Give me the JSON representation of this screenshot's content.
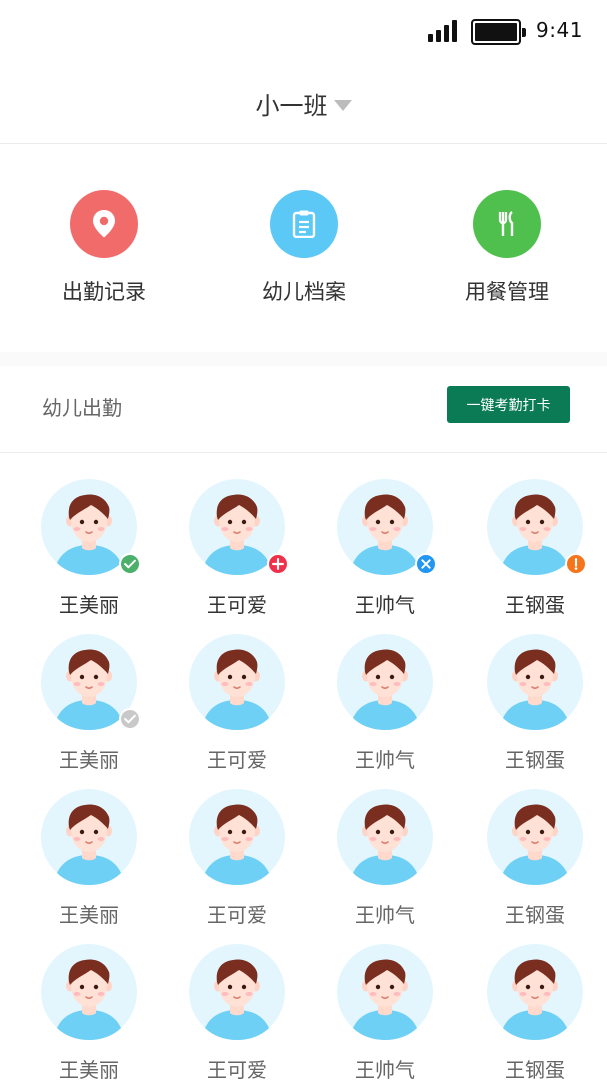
{
  "status_bar": {
    "time": "9:41",
    "signal_bars": 4,
    "battery_level": 1.0
  },
  "header": {
    "class_name": "小一班"
  },
  "quick_menu": [
    {
      "label": "出勤记录",
      "icon": "location-pin-icon",
      "color": "#f26b6b"
    },
    {
      "label": "幼儿档案",
      "icon": "clipboard-icon",
      "color": "#5cc8f5"
    },
    {
      "label": "用餐管理",
      "icon": "cutlery-icon",
      "color": "#4fc04d"
    }
  ],
  "attendance": {
    "title": "幼儿出勤",
    "checkin_button": "一键考勤打卡",
    "status_colors": {
      "present": "#4caf6a",
      "sick": "#f0304a",
      "absent": "#2196f3",
      "late": "#f5751a",
      "unchecked": "#c9c9c9"
    },
    "rows": [
      [
        {
          "name": "王美丽",
          "status": "present"
        },
        {
          "name": "王可爱",
          "status": "sick"
        },
        {
          "name": "王帅气",
          "status": "absent"
        },
        {
          "name": "王钢蛋",
          "status": "late"
        }
      ],
      [
        {
          "name": "王美丽",
          "status": "unchecked"
        },
        {
          "name": "王可爱",
          "status": ""
        },
        {
          "name": "王帅气",
          "status": ""
        },
        {
          "name": "王钢蛋",
          "status": ""
        }
      ],
      [
        {
          "name": "王美丽",
          "status": ""
        },
        {
          "name": "王可爱",
          "status": ""
        },
        {
          "name": "王帅气",
          "status": ""
        },
        {
          "name": "王钢蛋",
          "status": ""
        }
      ],
      [
        {
          "name": "王美丽",
          "status": ""
        },
        {
          "name": "王可爱",
          "status": ""
        },
        {
          "name": "王帅气",
          "status": ""
        },
        {
          "name": "王钢蛋",
          "status": ""
        }
      ]
    ]
  }
}
